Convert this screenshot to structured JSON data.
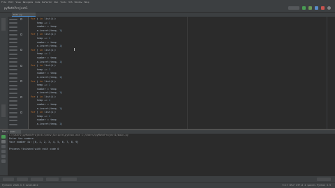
{
  "colors": {
    "background": "#2b2b2b",
    "chrome": "#3c3f41",
    "keyword": "#cc7832",
    "string": "#6a8759",
    "number": "#6897bb",
    "text": "#a9b7c6"
  },
  "menu": [
    "File",
    "Edit",
    "View",
    "Navigate",
    "Code",
    "Refactor",
    "Run",
    "Tools",
    "VCS",
    "Window",
    "Help"
  ],
  "project": {
    "name": "pyMathProject1"
  },
  "editor_tab": {
    "label": "main.py"
  },
  "toolbar_icons": [
    "run-config-icon",
    "run-icon",
    "debug-icon",
    "coverage-icon",
    "stop-icon",
    "search-icon"
  ],
  "code_lines": [
    [
      [
        "k",
        "for "
      ],
      [
        "v",
        "j "
      ],
      [
        "k",
        "in "
      ],
      [
        "v",
        "list(i):"
      ]
    ],
    [
      [
        "v",
        "    temp += "
      ],
      [
        "n",
        "1"
      ]
    ],
    [
      [
        "v",
        "    number = temp"
      ]
    ],
    [
      [
        "v",
        "    a.insert(temp, "
      ],
      [
        "n",
        "1"
      ],
      [
        "v",
        ")"
      ]
    ],
    [
      [
        "k",
        "for "
      ],
      [
        "v",
        "j "
      ],
      [
        "k",
        "in "
      ],
      [
        "v",
        "list(i):"
      ]
    ],
    [
      [
        "v",
        "    temp += "
      ],
      [
        "n",
        "1"
      ]
    ],
    [
      [
        "v",
        "    number = temp"
      ]
    ],
    [
      [
        "v",
        "    a.insert(temp, "
      ],
      [
        "n",
        "1"
      ],
      [
        "v",
        ")"
      ]
    ],
    [
      [
        "k",
        "for "
      ],
      [
        "v",
        "j "
      ],
      [
        "k",
        "in "
      ],
      [
        "v",
        "list(i):"
      ]
    ],
    [
      [
        "v",
        "    temp += "
      ],
      [
        "n",
        "1"
      ]
    ],
    [
      [
        "v",
        "    number = temp"
      ]
    ],
    [
      [
        "v",
        "    a.insert(temp, "
      ],
      [
        "n",
        "1"
      ],
      [
        "v",
        ")"
      ]
    ],
    [
      [
        "k",
        "for "
      ],
      [
        "v",
        "j "
      ],
      [
        "k",
        "in "
      ],
      [
        "v",
        "list(i):"
      ]
    ],
    [
      [
        "v",
        "    temp += "
      ],
      [
        "n",
        "1"
      ]
    ],
    [
      [
        "v",
        "    number = temp"
      ]
    ],
    [
      [
        "v",
        "    a.insert(temp, "
      ],
      [
        "n",
        "1"
      ],
      [
        "v",
        ")"
      ]
    ],
    [
      [
        "k",
        "for "
      ],
      [
        "v",
        "j "
      ],
      [
        "k",
        "in "
      ],
      [
        "v",
        "list(i):"
      ]
    ],
    [
      [
        "v",
        "    temp += "
      ],
      [
        "n",
        "1"
      ]
    ],
    [
      [
        "v",
        "    number = temp"
      ]
    ],
    [
      [
        "v",
        "    a.insert(temp, "
      ],
      [
        "n",
        "1"
      ],
      [
        "v",
        ")"
      ]
    ],
    [
      [
        "k",
        "for "
      ],
      [
        "v",
        "j "
      ],
      [
        "k",
        "in "
      ],
      [
        "v",
        "list(i):"
      ]
    ],
    [
      [
        "v",
        "    temp += "
      ],
      [
        "n",
        "1"
      ]
    ],
    [
      [
        "v",
        "    number = temp"
      ]
    ],
    [
      [
        "v",
        "    a.insert(temp, "
      ],
      [
        "n",
        "1"
      ],
      [
        "v",
        ")"
      ]
    ],
    [
      [
        "k",
        "for "
      ],
      [
        "v",
        "j "
      ],
      [
        "k",
        "in "
      ],
      [
        "v",
        "list(i):"
      ]
    ],
    [
      [
        "v",
        "    temp += "
      ],
      [
        "n",
        "1"
      ]
    ],
    [
      [
        "v",
        "    number = temp"
      ]
    ],
    [
      [
        "v",
        "    a.insert(temp, "
      ],
      [
        "n",
        "1"
      ],
      [
        "v",
        ")"
      ]
    ]
  ],
  "run": {
    "label": "Run:",
    "tab": "main",
    "command": "C:\\Users\\pyMathProject1\\venv\\Scripts\\python.exe C:/Users/pyMathProject1/main.py",
    "prompt": "Enter the number: ",
    "output": "Your number is: [0, 1, 2, 3, 4, 5, 6, 7, 8, 9]",
    "exit": "Process finished with exit code 0"
  },
  "status": {
    "text": "PyCharm 2020.3.5 available",
    "position": "9:17  CRLF  UTF-8  4 spaces  Python 3.9"
  }
}
